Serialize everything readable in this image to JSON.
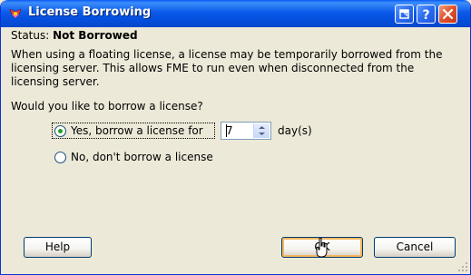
{
  "window": {
    "title": "License Borrowing",
    "title_icon": "license-ribbon-icon",
    "controls": [
      "help-popup-icon",
      "help-icon",
      "close-icon"
    ]
  },
  "status": {
    "label": "Status:",
    "value": "Not Borrowed"
  },
  "description": "When using a floating license, a license may be temporarily borrowed from the licensing server. This allows FME to run even when disconnected from the licensing server.",
  "question": "Would you like to borrow a license?",
  "options": {
    "yes_label": "Yes, borrow a license for",
    "yes_selected": true,
    "days_value": "7",
    "days_unit": "day(s)",
    "no_label": "No, don't borrow a license",
    "no_selected": false
  },
  "buttons": {
    "help": "Help",
    "ok": "OK",
    "cancel": "Cancel"
  },
  "colors": {
    "titlebar": "#0550DE",
    "dialog_bg": "#ECE9D8",
    "radio_dot": "#21A121",
    "default_button_highlight": "#F8B75D"
  }
}
